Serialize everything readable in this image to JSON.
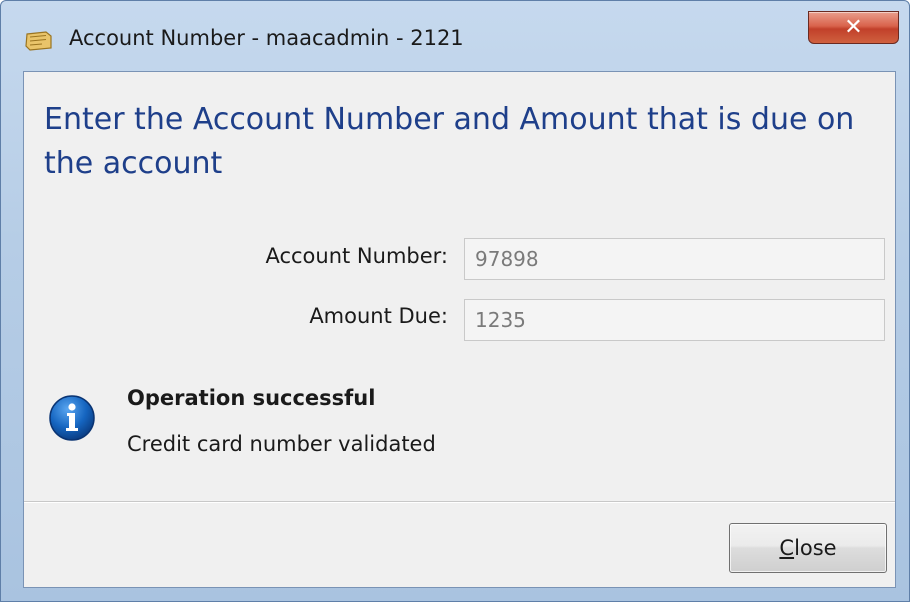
{
  "window": {
    "title": "Account Number - maacadmin - 2121",
    "close_glyph": "✕"
  },
  "dialog": {
    "heading": "Enter the Account Number and Amount that is due on the account",
    "fields": {
      "account_number": {
        "label": "Account Number:",
        "value": "97898"
      },
      "amount_due": {
        "label": "Amount Due:",
        "value": "1235"
      }
    },
    "message": {
      "icon": "info-icon",
      "title": "Operation successful",
      "body": "Credit card number validated"
    },
    "buttons": {
      "close": {
        "accel_char": "C",
        "rest": "lose"
      }
    }
  },
  "colors": {
    "heading": "#1e3f8a",
    "info_icon": "#1565c0",
    "close_x": "#c8452f"
  }
}
